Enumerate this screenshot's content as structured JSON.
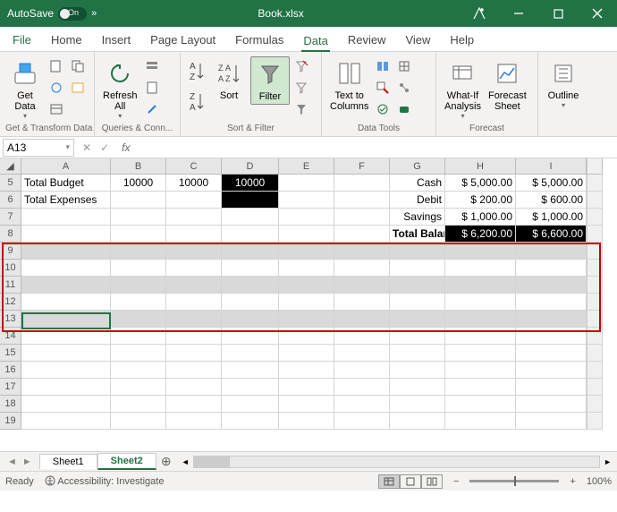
{
  "titlebar": {
    "autosave_label": "AutoSave",
    "autosave_state": "On",
    "filename": "Book.xlsx"
  },
  "tabs": {
    "file": "File",
    "home": "Home",
    "insert": "Insert",
    "page_layout": "Page Layout",
    "formulas": "Formulas",
    "data": "Data",
    "review": "Review",
    "view": "View",
    "help": "Help"
  },
  "ribbon": {
    "get_data": "Get\nData",
    "group_get": "Get & Transform Data",
    "refresh": "Refresh\nAll",
    "group_queries": "Queries & Conn...",
    "sort": "Sort",
    "filter": "Filter",
    "group_sortfilter": "Sort & Filter",
    "text_cols": "Text to\nColumns",
    "group_tools": "Data Tools",
    "whatif": "What-If\nAnalysis",
    "forecast": "Forecast\nSheet",
    "group_forecast": "Forecast",
    "outline": "Outline"
  },
  "namebox": {
    "ref": "A13",
    "fx": "fx"
  },
  "columns": [
    "A",
    "B",
    "C",
    "D",
    "E",
    "F",
    "G",
    "H",
    "I"
  ],
  "rows": [
    "5",
    "6",
    "7",
    "8",
    "9",
    "10",
    "11",
    "12",
    "13",
    "14",
    "15",
    "16",
    "17",
    "18",
    "19"
  ],
  "grid": {
    "5": {
      "A": "Total Budget",
      "B": "10000",
      "C": "10000",
      "D": "10000",
      "G": "Cash",
      "H": "$  5,000.00",
      "I": "$    5,000.00"
    },
    "6": {
      "A": "Total Expenses",
      "G": "Debit",
      "H": "$     200.00",
      "I": "$       600.00"
    },
    "7": {
      "G": "Savings",
      "H": "$  1,000.00",
      "I": "$    1,000.00"
    },
    "8": {
      "G": "Total Balance:",
      "H": "$  6,200.00",
      "I": "$    6,600.00"
    }
  },
  "sheets": {
    "s1": "Sheet1",
    "s2": "Sheet2"
  },
  "status": {
    "ready": "Ready",
    "accessibility": "Accessibility: Investigate",
    "zoom": "100%"
  }
}
